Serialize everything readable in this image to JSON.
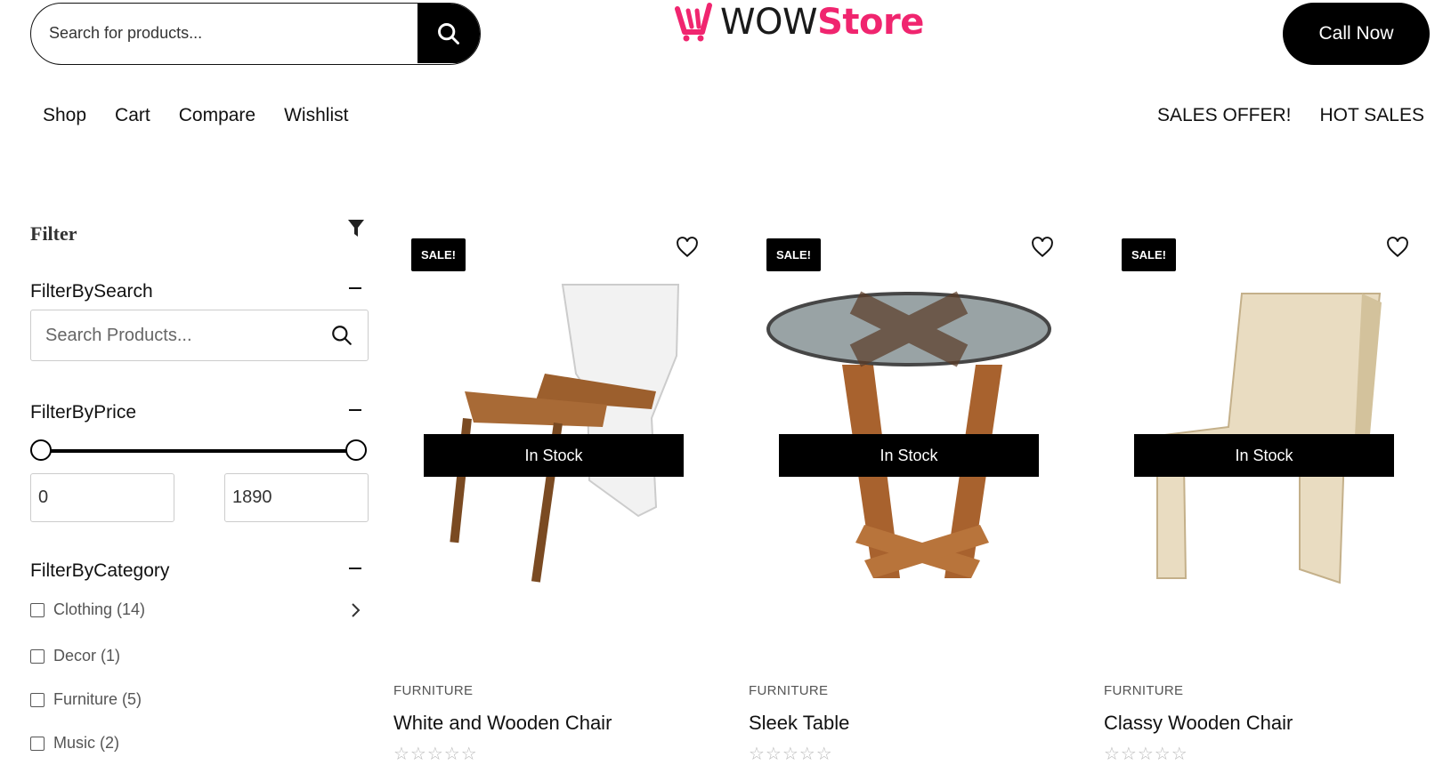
{
  "header": {
    "search_placeholder": "Search for products...",
    "logo_wow": "WOW",
    "logo_store": "Store",
    "call_label": "Call Now"
  },
  "nav": {
    "left": [
      "Shop",
      "Cart",
      "Compare",
      "Wishlist"
    ],
    "right": [
      "SALES OFFER!",
      "HOT SALES"
    ]
  },
  "sidebar": {
    "title": "Filter",
    "search": {
      "title": "FilterBySearch",
      "placeholder": "Search Products..."
    },
    "price": {
      "title": "FilterByPrice",
      "min": "0",
      "max": "1890"
    },
    "category": {
      "title": "FilterByCategory",
      "items": [
        "Clothing (14)",
        "Decor (1)",
        "Furniture (5)",
        "Music (2)"
      ]
    }
  },
  "products": [
    {
      "badge": "SALE!",
      "stock": "In Stock",
      "category": "FURNITURE",
      "name": "White and Wooden Chair",
      "stars": "☆☆☆☆☆"
    },
    {
      "badge": "SALE!",
      "stock": "In Stock",
      "category": "FURNITURE",
      "name": "Sleek Table",
      "stars": "☆☆☆☆☆"
    },
    {
      "badge": "SALE!",
      "stock": "In Stock",
      "category": "FURNITURE",
      "name": "Classy Wooden Chair",
      "stars": "☆☆☆☆☆"
    }
  ],
  "colors": {
    "brand": "#f0256f",
    "primary": "#000000"
  },
  "icons": [
    "search-icon",
    "filter-funnel-icon",
    "heart-icon",
    "chevron-right-icon",
    "logo-cart-icon"
  ]
}
